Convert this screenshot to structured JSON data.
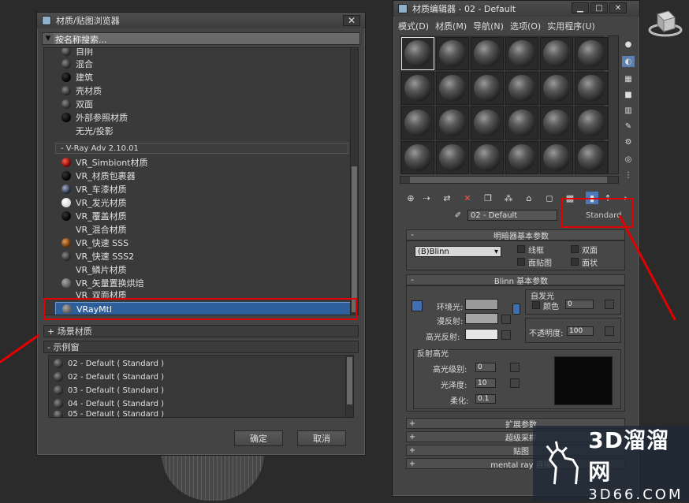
{
  "browser": {
    "title": "材质/贴图浏览器",
    "search_placeholder": "按名称搜索...",
    "items_top": [
      "自阴",
      "混合",
      "建筑",
      "壳材质",
      "双面",
      "外部参照材质",
      "无光/投影"
    ],
    "vray_group": "- V-Ray Adv 2.10.01",
    "vray_items": [
      "VR_Simbiont材质",
      "VR_材质包裹器",
      "VR_车漆材质",
      "VR_发光材质",
      "VR_覆盖材质",
      "VR_混合材质",
      "VR_快速 SSS",
      "VR_快速 SSS2",
      "VR_鳞片材质",
      "VR_矢量置换烘焙",
      "VR_双面材质"
    ],
    "selected_item": "VRayMtl",
    "scene_section": "+ 场景材质",
    "sample_section": "- 示例窗",
    "sample_items": [
      "02 - Default ( Standard )",
      "02 - Default ( Standard )",
      "03 - Default ( Standard )",
      "04 - Default ( Standard )",
      "05 - Default ( Standard )"
    ],
    "ok_label": "确定",
    "cancel_label": "取消"
  },
  "editor": {
    "title": "材质编辑器 - 02 - Default",
    "menus": [
      "模式(D)",
      "材质(M)",
      "导航(N)",
      "选项(O)",
      "实用程序(U)"
    ],
    "material_name": "02 - Default",
    "material_type": "Standard",
    "shader_rollout": "明暗器基本参数",
    "shader_value": "(B)Blinn",
    "shader_checks": [
      "线框",
      "双面",
      "面贴图",
      "面状"
    ],
    "blinn_rollout": "Blinn 基本参数",
    "self_illum_label": "自发光",
    "color_label": "颜色",
    "color_value": "0",
    "ambient_label": "环境光:",
    "diffuse_label": "漫反射:",
    "specular_label": "高光反射:",
    "opacity_label": "不透明度:",
    "opacity_value": "100",
    "highlight_section": "反射高光",
    "spec_level_label": "高光级别:",
    "spec_level_value": "0",
    "gloss_label": "光泽度:",
    "gloss_value": "10",
    "soften_label": "柔化:",
    "soften_value": "0.1",
    "ext_rollout": "扩展参数",
    "super_rollout": "超级采样",
    "maps_rollout": "贴图",
    "mr_rollout": "mental ray 连接"
  },
  "watermark": {
    "line1": "3D溜溜网",
    "line2": "3D66.COM"
  },
  "colors": {
    "selection": "#2f5f9a",
    "highlight_box": "#e40000"
  }
}
